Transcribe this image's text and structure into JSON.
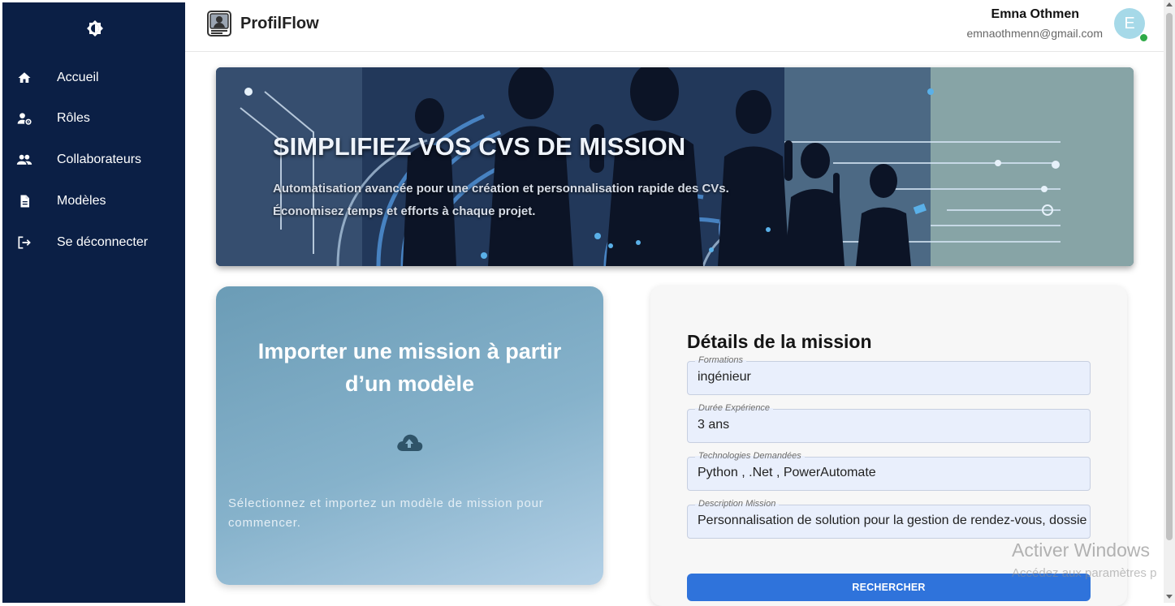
{
  "sidebar": {
    "items": [
      {
        "label": "Accueil",
        "icon": "home-icon"
      },
      {
        "label": "Rôles",
        "icon": "user-gear-icon"
      },
      {
        "label": "Collaborateurs",
        "icon": "people-icon"
      },
      {
        "label": "Modèles",
        "icon": "document-icon"
      },
      {
        "label": "Se déconnecter",
        "icon": "logout-icon"
      }
    ]
  },
  "header": {
    "app_name": "ProfilFlow",
    "user_name": "Emna Othmen",
    "user_email": "emnaothmenn@gmail.com",
    "avatar_letter": "E"
  },
  "hero": {
    "title": "SIMPLIFIEZ VOS CVS DE MISSION",
    "subtitle_line1": "Automatisation avancée pour une création et personnalisation rapide des CVs.",
    "subtitle_line2": "Économisez temps et efforts à chaque projet."
  },
  "import_card": {
    "title": "Importer une mission à partir d’un modèle",
    "description": "Sélectionnez et importez un modèle de mission pour commencer."
  },
  "details": {
    "title": "Détails de la mission",
    "fields": [
      {
        "label": "Formations",
        "value": "ingénieur"
      },
      {
        "label": "Durée Expérience",
        "value": "3 ans"
      },
      {
        "label": "Technologies Demandées",
        "value": "Python , .Net , PowerAutomate"
      },
      {
        "label": "Description Mission",
        "value": "Personnalisation de solution pour la gestion de rendez-vous, dossiers"
      }
    ],
    "button_label": "RECHERCHER"
  },
  "watermark": {
    "line1": "Activer Windows",
    "line2": "Accédez aux paramètres p"
  },
  "colors": {
    "sidebar_bg": "#0b1f45",
    "primary_button": "#2f73db",
    "avatar_bg": "#a6d9e8",
    "online_status": "#2eaa47"
  }
}
